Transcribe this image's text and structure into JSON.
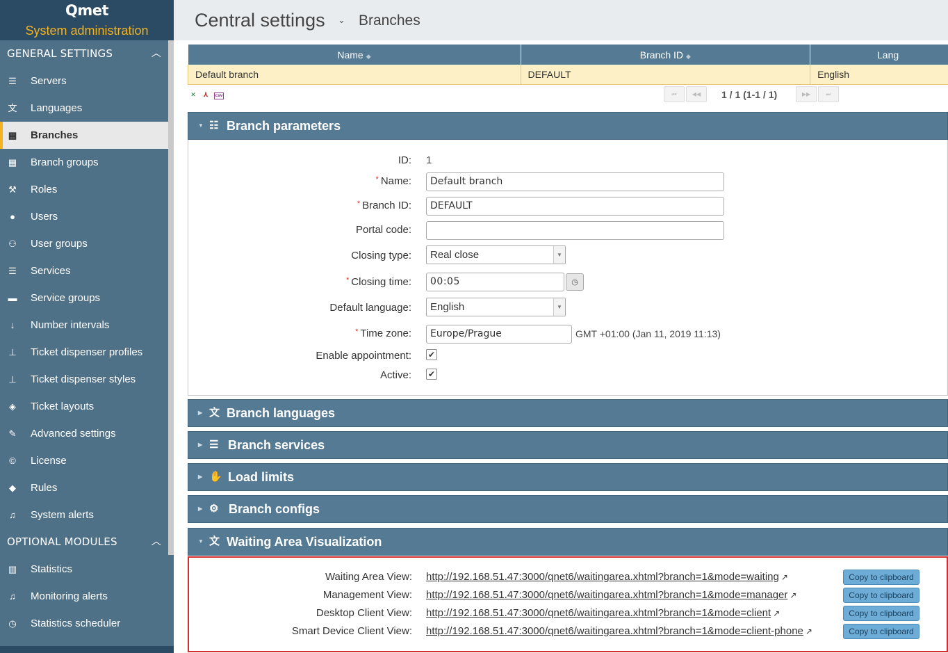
{
  "app": {
    "brand": "Qmet",
    "subtitle": "System administration"
  },
  "sidebar": {
    "general_heading": "GENERAL SETTINGS",
    "general_items": [
      {
        "label": "Servers",
        "icon": "server-icon"
      },
      {
        "label": "Languages",
        "icon": "language-icon"
      },
      {
        "label": "Branches",
        "icon": "building-icon",
        "active": true
      },
      {
        "label": "Branch groups",
        "icon": "building-group-icon"
      },
      {
        "label": "Roles",
        "icon": "gavel-icon"
      },
      {
        "label": "Users",
        "icon": "user-icon"
      },
      {
        "label": "User groups",
        "icon": "users-icon"
      },
      {
        "label": "Services",
        "icon": "list-icon"
      },
      {
        "label": "Service groups",
        "icon": "folder-icon"
      },
      {
        "label": "Number intervals",
        "icon": "sort-numeric-icon"
      },
      {
        "label": "Ticket dispenser profiles",
        "icon": "sitemap-icon"
      },
      {
        "label": "Ticket dispenser styles",
        "icon": "sitemap-icon"
      },
      {
        "label": "Ticket layouts",
        "icon": "ticket-icon"
      },
      {
        "label": "Advanced settings",
        "icon": "wrench-icon"
      },
      {
        "label": "License",
        "icon": "copyright-icon"
      },
      {
        "label": "Rules",
        "icon": "graduation-cap-icon"
      },
      {
        "label": "System alerts",
        "icon": "bell-outline-icon"
      }
    ],
    "optional_heading": "OPTIONAL MODULES",
    "optional_items": [
      {
        "label": "Statistics",
        "icon": "bar-chart-icon"
      },
      {
        "label": "Monitoring alerts",
        "icon": "bell-icon"
      },
      {
        "label": "Statistics scheduler",
        "icon": "clock-icon"
      }
    ]
  },
  "header": {
    "title": "Central settings",
    "breadcrumb": "Branches"
  },
  "grid": {
    "columns": [
      "Name",
      "Branch ID",
      "Lang"
    ],
    "rows": [
      [
        "Default branch",
        "DEFAULT",
        "English"
      ]
    ],
    "pagination": "1 / 1 (1-1 / 1)"
  },
  "branch_parameters": {
    "title": "Branch parameters",
    "id_label": "ID:",
    "id_value": "1",
    "name_label": "Name:",
    "name_value": "Default branch",
    "branch_id_label": "Branch ID:",
    "branch_id_value": "DEFAULT",
    "portal_code_label": "Portal code:",
    "portal_code_value": "",
    "closing_type_label": "Closing type:",
    "closing_type_value": "Real close",
    "closing_time_label": "Closing time:",
    "closing_time_value": "00:05",
    "default_language_label": "Default language:",
    "default_language_value": "English",
    "time_zone_label": "Time zone:",
    "time_zone_value": "Europe/Prague",
    "time_zone_note": "GMT +01:00 (Jan 11, 2019 11:13)",
    "enable_appointment_label": "Enable appointment:",
    "enable_appointment_checked": true,
    "active_label": "Active:",
    "active_checked": true
  },
  "panels": {
    "branch_languages": "Branch languages",
    "branch_services": "Branch services",
    "load_limits": "Load limits",
    "branch_configs": "Branch configs",
    "waiting_area": "Waiting Area Visualization"
  },
  "waiting_area": {
    "copy_label": "Copy to clipboard",
    "rows": [
      {
        "label": "Waiting Area View:",
        "url": "http://192.168.51.47:3000/qnet6/waitingarea.xhtml?branch=1&mode=waiting"
      },
      {
        "label": "Management View:",
        "url": "http://192.168.51.47:3000/qnet6/waitingarea.xhtml?branch=1&mode=manager"
      },
      {
        "label": "Desktop Client View:",
        "url": "http://192.168.51.47:3000/qnet6/waitingarea.xhtml?branch=1&mode=client"
      },
      {
        "label": "Smart Device Client View:",
        "url": "http://192.168.51.47:3000/qnet6/waitingarea.xhtml?branch=1&mode=client-phone"
      }
    ]
  },
  "colors": {
    "accent": "#f5b41e",
    "sidebar": "#4f7188",
    "header_bar": "#557a93",
    "highlight_row": "#fdf0c7",
    "alert_border": "#d32f2f"
  }
}
